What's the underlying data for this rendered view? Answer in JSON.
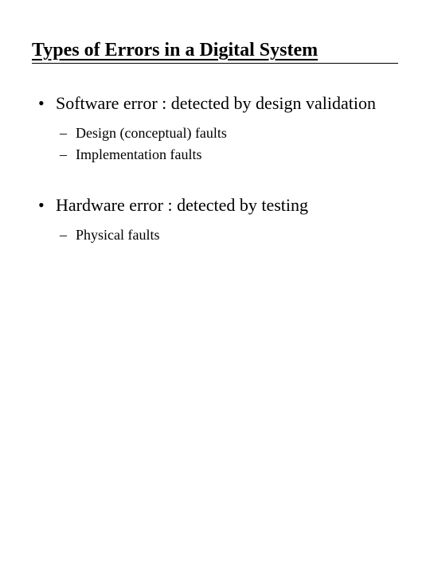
{
  "title": "Types of Errors in a Digital System",
  "items": [
    {
      "text": "Software error : detected by design validation",
      "subitems": [
        "Design (conceptual) faults",
        "Implementation faults"
      ]
    },
    {
      "text": "Hardware error : detected by testing",
      "subitems": [
        "Physical faults"
      ]
    }
  ]
}
